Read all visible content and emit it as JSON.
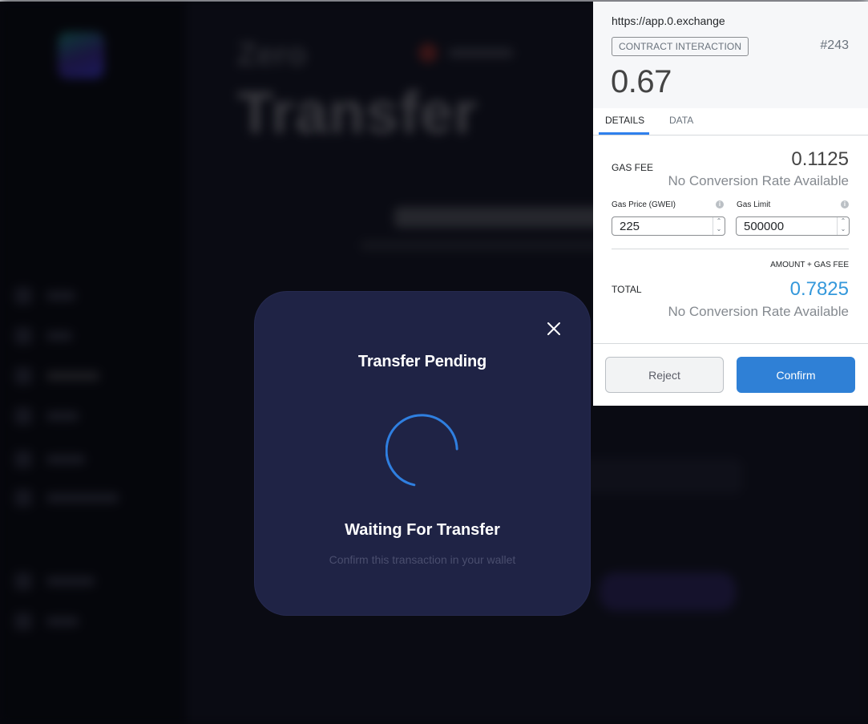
{
  "background_app": {
    "brand": "Zero",
    "page_title": "Transfer",
    "note": "blurred background content"
  },
  "pending_modal": {
    "title": "Transfer Pending",
    "status": "Waiting For Transfer",
    "hint": "Confirm this transaction in your wallet",
    "close_icon": "close-icon",
    "spinner_icon": "loading-spinner-icon",
    "spinner_color": "#2f7fe0",
    "background_color": "#1f2345"
  },
  "wallet": {
    "origin": "https://app.0.exchange",
    "badge": "CONTRACT INTERACTION",
    "nonce": "#243",
    "amount": "0.67",
    "tabs": [
      {
        "label": "DETAILS",
        "active": true
      },
      {
        "label": "DATA",
        "active": false
      }
    ],
    "gas_fee": {
      "label": "GAS FEE",
      "value": "0.1125",
      "conversion": "No Conversion Rate Available"
    },
    "gas_price": {
      "label": "Gas Price (GWEI)",
      "value": "225",
      "info_icon": "info-icon"
    },
    "gas_limit": {
      "label": "Gas Limit",
      "value": "500000",
      "info_icon": "info-icon"
    },
    "total": {
      "sublabel": "AMOUNT + GAS FEE",
      "label": "TOTAL",
      "value": "0.7825",
      "conversion": "No Conversion Rate Available",
      "color": "#3498db"
    },
    "buttons": {
      "reject": "Reject",
      "confirm": "Confirm",
      "confirm_color": "#2f80d6"
    },
    "stepper": {
      "up": "⌃",
      "down": "⌄"
    },
    "info_glyph": "i"
  }
}
